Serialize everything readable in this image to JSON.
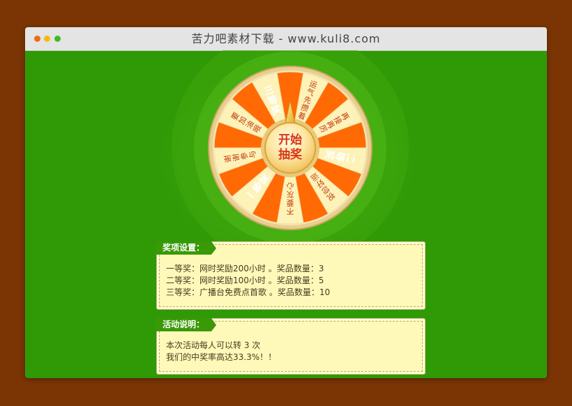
{
  "window": {
    "title": "苦力吧素材下载 - www.kuli8.com"
  },
  "wheel": {
    "center_button_line1": "开始",
    "center_button_line2": "抽奖",
    "segments": [
      {
        "label": "运气先攒着",
        "kind": "miss"
      },
      {
        "label": "再接再厉",
        "kind": "miss"
      },
      {
        "label": "二等奖",
        "kind": "prize"
      },
      {
        "label": "祝您好运",
        "kind": "miss"
      },
      {
        "label": "不要灰心",
        "kind": "miss"
      },
      {
        "label": "一等奖",
        "kind": "prize"
      },
      {
        "label": "谢谢参与",
        "kind": "miss"
      },
      {
        "label": "要加油哦",
        "kind": "miss"
      },
      {
        "label": "三等奖",
        "kind": "prize"
      }
    ],
    "colors": {
      "orange": "#ff6a05",
      "cream": "#fdf3b8",
      "prize_text": "#ffffff",
      "miss_text": "#c33a10",
      "rim": "#e8cf8f",
      "glow": "#4fb811"
    }
  },
  "prizes_panel": {
    "heading": "奖项设置：",
    "lines": [
      "一等奖：网时奖励200小时 。奖品数量：3",
      "二等奖：网时奖励100小时 。奖品数量：5",
      "三等奖：广播台免费点首歌 。奖品数量：10"
    ]
  },
  "rules_panel": {
    "heading": "活动说明：",
    "lines": [
      "本次活动每人可以转 3 次",
      "我们的中奖率高达33.3%！！"
    ]
  }
}
